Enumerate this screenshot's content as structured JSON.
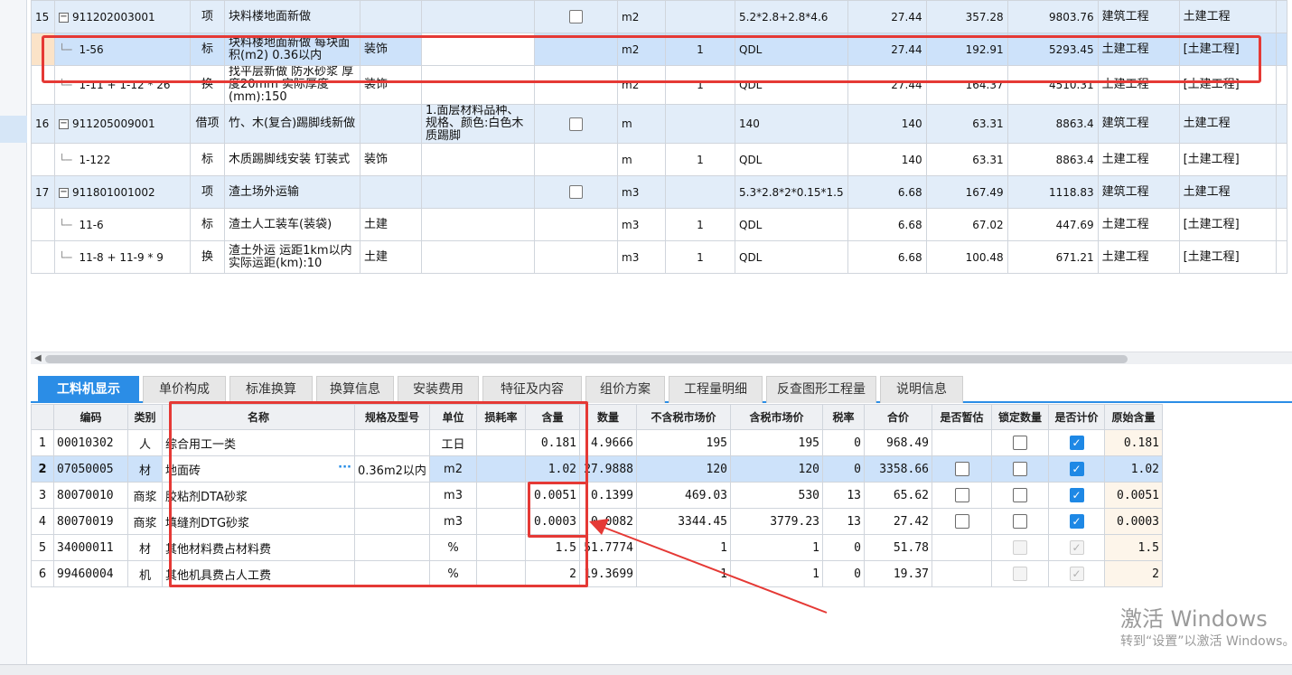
{
  "top_rows": [
    {
      "type": "item",
      "seq": "15",
      "code": "911202003001",
      "cat": "项",
      "name": "块料楼地面新做",
      "major": "",
      "feature": "",
      "unit": "m2",
      "qty_expr": "",
      "expr": "5.2*2.8+2.8*4.6",
      "qty": "27.44",
      "price": "357.28",
      "total": "9803.76",
      "prof": "建筑工程",
      "spec": "土建工程"
    },
    {
      "type": "sel",
      "seq": "",
      "code": "1-56",
      "cat": "标",
      "name": "块料楼地面新做 每块面积(m2) 0.36以内",
      "major": "装饰",
      "feature": "",
      "unit": "m2",
      "qty_expr": "1",
      "expr": "QDL",
      "qty": "27.44",
      "price": "192.91",
      "total": "5293.45",
      "prof": "土建工程",
      "spec": "[土建工程]"
    },
    {
      "type": "sub",
      "seq": "",
      "code": "1-11 + 1-12 * 26",
      "cat": "换",
      "name": "找平层新做 防水砂浆 厚度20mm 实际厚度(mm):150",
      "major": "装饰",
      "feature": "",
      "unit": "m2",
      "qty_expr": "1",
      "expr": "QDL",
      "qty": "27.44",
      "price": "164.37",
      "total": "4510.31",
      "prof": "土建工程",
      "spec": "[土建工程]"
    },
    {
      "type": "item",
      "seq": "16",
      "code": "911205009001",
      "cat": "借项",
      "name": "竹、木(复合)踢脚线新做",
      "major": "",
      "feature": "1.面层材料品种、规格、颜色:白色木质踢脚",
      "unit": "m",
      "qty_expr": "",
      "expr": "140",
      "qty": "140",
      "price": "63.31",
      "total": "8863.4",
      "prof": "建筑工程",
      "spec": "土建工程"
    },
    {
      "type": "sub",
      "seq": "",
      "code": "1-122",
      "cat": "标",
      "name": "木质踢脚线安装 钉装式",
      "major": "装饰",
      "feature": "",
      "unit": "m",
      "qty_expr": "1",
      "expr": "QDL",
      "qty": "140",
      "price": "63.31",
      "total": "8863.4",
      "prof": "土建工程",
      "spec": "[土建工程]"
    },
    {
      "type": "item",
      "seq": "17",
      "code": "911801001002",
      "cat": "项",
      "name": "渣土场外运输",
      "major": "",
      "feature": "",
      "unit": "m3",
      "qty_expr": "",
      "expr": "5.3*2.8*2*0.15*1.5",
      "qty": "6.68",
      "price": "167.49",
      "total": "1118.83",
      "prof": "建筑工程",
      "spec": "土建工程"
    },
    {
      "type": "sub",
      "seq": "",
      "code": "11-6",
      "cat": "标",
      "name": "渣土人工装车(装袋)",
      "major": "土建",
      "feature": "",
      "unit": "m3",
      "qty_expr": "1",
      "expr": "QDL",
      "qty": "6.68",
      "price": "67.02",
      "total": "447.69",
      "prof": "土建工程",
      "spec": "[土建工程]"
    },
    {
      "type": "sub",
      "seq": "",
      "code": "11-8 + 11-9 * 9",
      "cat": "换",
      "name": "渣土外运 运距1km以内 实际运距(km):10",
      "major": "土建",
      "feature": "",
      "unit": "m3",
      "qty_expr": "1",
      "expr": "QDL",
      "qty": "6.68",
      "price": "100.48",
      "total": "671.21",
      "prof": "土建工程",
      "spec": "[土建工程]"
    }
  ],
  "tabs": [
    "工料机显示",
    "单价构成",
    "标准换算",
    "换算信息",
    "安装费用",
    "特征及内容",
    "组价方案",
    "工程量明细",
    "反查图形工程量",
    "说明信息"
  ],
  "columns": [
    "编码",
    "类别",
    "名称",
    "规格及型号",
    "单位",
    "损耗率",
    "含量",
    "数量",
    "不含税市场价",
    "含税市场价",
    "税率",
    "合价",
    "是否暂估",
    "锁定数量",
    "是否计价",
    "原始含量"
  ],
  "rows": [
    {
      "seq": "1",
      "code": "00010302",
      "cat": "人",
      "name": "综合用工一类",
      "spec": "",
      "unit": "工日",
      "loss": "",
      "content": "0.181",
      "qty": "4.9666",
      "price_ex": "195",
      "price_in": "195",
      "tax": "0",
      "total": "968.49",
      "est": "",
      "lock": "off",
      "priced": "on",
      "orig": "0.181"
    },
    {
      "seq": "2",
      "code": "07050005",
      "cat": "材",
      "name": "地面砖",
      "spec": "0.36m2以内",
      "unit": "m2",
      "loss": "",
      "content": "1.02",
      "qty": "27.9888",
      "price_ex": "120",
      "price_in": "120",
      "tax": "0",
      "total": "3358.66",
      "est": "off",
      "lock": "off",
      "priced": "on",
      "orig": "1.02"
    },
    {
      "seq": "3",
      "code": "80070010",
      "cat": "商浆",
      "name": "胶粘剂DTA砂浆",
      "spec": "",
      "unit": "m3",
      "loss": "",
      "content": "0.0051",
      "qty": "0.1399",
      "price_ex": "469.03",
      "price_in": "530",
      "tax": "13",
      "total": "65.62",
      "est": "off",
      "lock": "off",
      "priced": "on",
      "orig": "0.0051"
    },
    {
      "seq": "4",
      "code": "80070019",
      "cat": "商浆",
      "name": "填缝剂DTG砂浆",
      "spec": "",
      "unit": "m3",
      "loss": "",
      "content": "0.0003",
      "qty": "0.0082",
      "price_ex": "3344.45",
      "price_in": "3779.23",
      "tax": "13",
      "total": "27.42",
      "est": "off",
      "lock": "off",
      "priced": "on",
      "orig": "0.0003"
    },
    {
      "seq": "5",
      "code": "34000011",
      "cat": "材",
      "name": "其他材料费占材料费",
      "spec": "",
      "unit": "%",
      "loss": "",
      "content": "1.5",
      "qty": "51.7774",
      "price_ex": "1",
      "price_in": "1",
      "tax": "0",
      "total": "51.78",
      "est": "",
      "lock": "dis",
      "priced": "dis-on",
      "orig": "1.5"
    },
    {
      "seq": "6",
      "code": "99460004",
      "cat": "机",
      "name": "其他机具费占人工费",
      "spec": "",
      "unit": "%",
      "loss": "",
      "content": "2",
      "qty": "19.3699",
      "price_ex": "1",
      "price_in": "1",
      "tax": "0",
      "total": "19.37",
      "est": "",
      "lock": "dis",
      "priced": "dis-on",
      "orig": "2"
    }
  ],
  "watermark": {
    "line1": "激活 Windows",
    "line2": "转到“设置”以激活 Windows。"
  },
  "colors": {
    "accent": "#2b8de6",
    "highlight": "#e53935",
    "selected_row": "#cde2fa",
    "item_row": "#e2edf9"
  }
}
